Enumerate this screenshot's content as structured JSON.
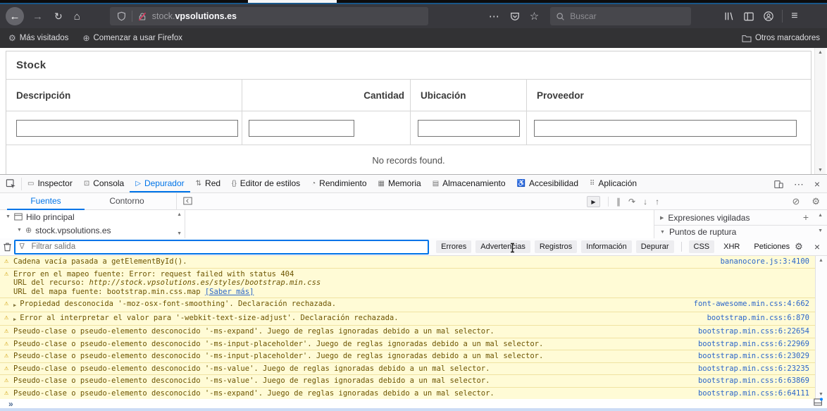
{
  "colors": {
    "accent_blue": "#0074e8",
    "chrome_dark": "#38383d",
    "warning_bg": "#fffbd6",
    "warning_text": "#6c5400",
    "link_blue": "#2b66c9",
    "insecure_red": "#e8355f"
  },
  "icons": {
    "back": "←",
    "forward": "→",
    "reload": "↻",
    "home": "⌂",
    "page_actions": "⋯",
    "star": "☆",
    "hamburger": "≡",
    "bookmark_gear": "⚙",
    "globe": "⊕",
    "warning": "⚠",
    "caret_right": "▶",
    "caret_down": "▼",
    "scroll_up": "▲",
    "scroll_down": "▼",
    "plus": "+",
    "close": "×",
    "gear": "⚙",
    "funnel": "∇",
    "pause": "∥",
    "step_over": "↷",
    "step_into": "↓",
    "step_out": "↑",
    "resume": "▶",
    "disable_breakpoints": "⊘",
    "prompt_more": "»"
  },
  "browser": {
    "nav": {
      "url_subdomain": "stock.",
      "url_domain": "vpsolutions.es",
      "search_placeholder": "Buscar"
    },
    "bookmarks_bar": {
      "items": [
        {
          "label": "Más visitados"
        },
        {
          "label": "Comenzar a usar Firefox"
        }
      ],
      "right_label": "Otros marcadores"
    }
  },
  "page": {
    "title": "Stock",
    "table": {
      "columns": [
        {
          "label": "Descripción"
        },
        {
          "label": "Cantidad"
        },
        {
          "label": "Ubicación"
        },
        {
          "label": "Proveedor"
        }
      ],
      "empty_message": "No records found."
    }
  },
  "devtools": {
    "tabs": [
      {
        "label": "Inspector",
        "icon": "▭"
      },
      {
        "label": "Consola",
        "icon": "⊡"
      },
      {
        "label": "Depurador",
        "icon": "▷"
      },
      {
        "label": "Red",
        "icon": "⇅"
      },
      {
        "label": "Editor de estilos",
        "icon": "{}"
      },
      {
        "label": "Rendimiento",
        "icon": "◔"
      },
      {
        "label": "Memoria",
        "icon": "▦"
      },
      {
        "label": "Almacenamiento",
        "icon": "▤"
      },
      {
        "label": "Accesibilidad",
        "icon": "♿"
      },
      {
        "label": "Aplicación",
        "icon": "⠿"
      }
    ],
    "debugger": {
      "source_tabs": [
        {
          "label": "Fuentes"
        },
        {
          "label": "Contorno"
        }
      ],
      "tree": [
        {
          "label": "Hilo principal"
        },
        {
          "label": "stock.vpsolutions.es"
        }
      ],
      "watch_label": "Expresiones vigiladas",
      "breakpoints_label": "Puntos de ruptura"
    },
    "console": {
      "filter_placeholder": "Filtrar salida",
      "filter_buttons": [
        {
          "label": "Errores"
        },
        {
          "label": "Advertencias"
        },
        {
          "label": "Registros"
        },
        {
          "label": "Información"
        },
        {
          "label": "Depurar"
        }
      ],
      "filter_buttons2": [
        {
          "label": "CSS"
        },
        {
          "label": "XHR"
        },
        {
          "label": "Peticiones"
        }
      ],
      "prompt": "»",
      "messages": [
        {
          "text": "Cadena vacía pasada a getElementById().",
          "link": "bananocore.js:3:4100"
        },
        {
          "line1": "Error en el mapeo fuente: Error: request failed with status 404",
          "line2_label": "URL del recurso: ",
          "line2_url": "http://stock.vpsolutions.es/styles/bootstrap.min.css",
          "line3_label": "URL del mapa fuente: bootstrap.min.css.map ",
          "line3_link": "[Saber más]"
        },
        {
          "text": "Propiedad desconocida '-moz-osx-font-smoothing'.  Declaración rechazada.",
          "link": "font-awesome.min.css:4:662"
        },
        {
          "text": "Error al interpretar el valor para '-webkit-text-size-adjust'.  Declaración rechazada.",
          "link": "bootstrap.min.css:6:870"
        },
        {
          "text": "Pseudo-clase o pseudo-elemento desconocido '-ms-expand'.  Juego de reglas ignoradas debido a un mal selector.",
          "link": "bootstrap.min.css:6:22654"
        },
        {
          "text": "Pseudo-clase o pseudo-elemento desconocido '-ms-input-placeholder'.  Juego de reglas ignoradas debido a un mal selector.",
          "link": "bootstrap.min.css:6:22969"
        },
        {
          "text": "Pseudo-clase o pseudo-elemento desconocido '-ms-input-placeholder'.  Juego de reglas ignoradas debido a un mal selector.",
          "link": "bootstrap.min.css:6:23029"
        },
        {
          "text": "Pseudo-clase o pseudo-elemento desconocido '-ms-value'.  Juego de reglas ignoradas debido a un mal selector.",
          "link": "bootstrap.min.css:6:23235"
        },
        {
          "text": "Pseudo-clase o pseudo-elemento desconocido '-ms-value'.  Juego de reglas ignoradas debido a un mal selector.",
          "link": "bootstrap.min.css:6:63869"
        },
        {
          "text": "Pseudo-clase o pseudo-elemento desconocido '-ms-expand'.  Juego de reglas ignoradas debido a un mal selector.",
          "link": "bootstrap.min.css:6:64111"
        }
      ]
    }
  }
}
